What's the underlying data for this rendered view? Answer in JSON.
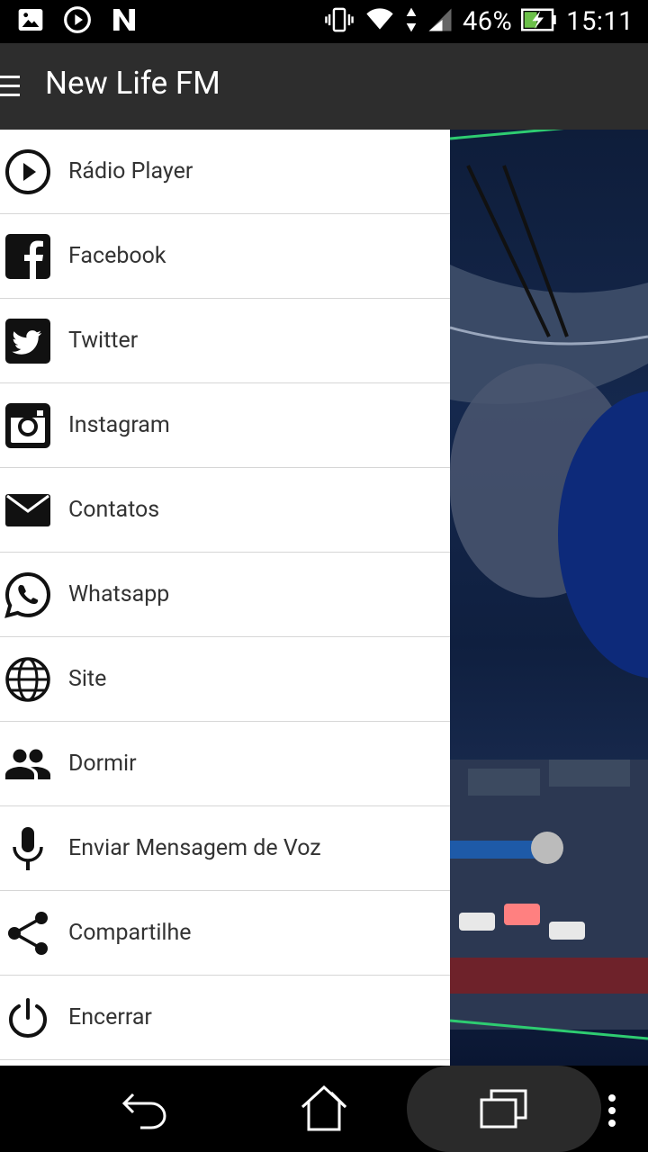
{
  "status_bar": {
    "battery": "46%",
    "time": "15:11"
  },
  "toolbar": {
    "title": "New Life FM"
  },
  "drawer": {
    "items": [
      {
        "label": "Rádio Player",
        "icon": "play-circle-icon"
      },
      {
        "label": "Facebook",
        "icon": "facebook-icon"
      },
      {
        "label": "Twitter",
        "icon": "twitter-icon"
      },
      {
        "label": "Instagram",
        "icon": "instagram-icon"
      },
      {
        "label": "Contatos",
        "icon": "mail-icon"
      },
      {
        "label": "Whatsapp",
        "icon": "whatsapp-icon"
      },
      {
        "label": "Site",
        "icon": "globe-icon"
      },
      {
        "label": "Dormir",
        "icon": "people-icon"
      },
      {
        "label": "Enviar Mensagem de Voz",
        "icon": "microphone-icon"
      },
      {
        "label": "Compartilhe",
        "icon": "share-icon"
      },
      {
        "label": "Encerrar",
        "icon": "power-icon"
      }
    ]
  },
  "colors": {
    "toolbar_bg": "#2d2d2d",
    "drawer_bg": "#ffffff",
    "divider": "#d6d6d6",
    "text": "#333333"
  }
}
